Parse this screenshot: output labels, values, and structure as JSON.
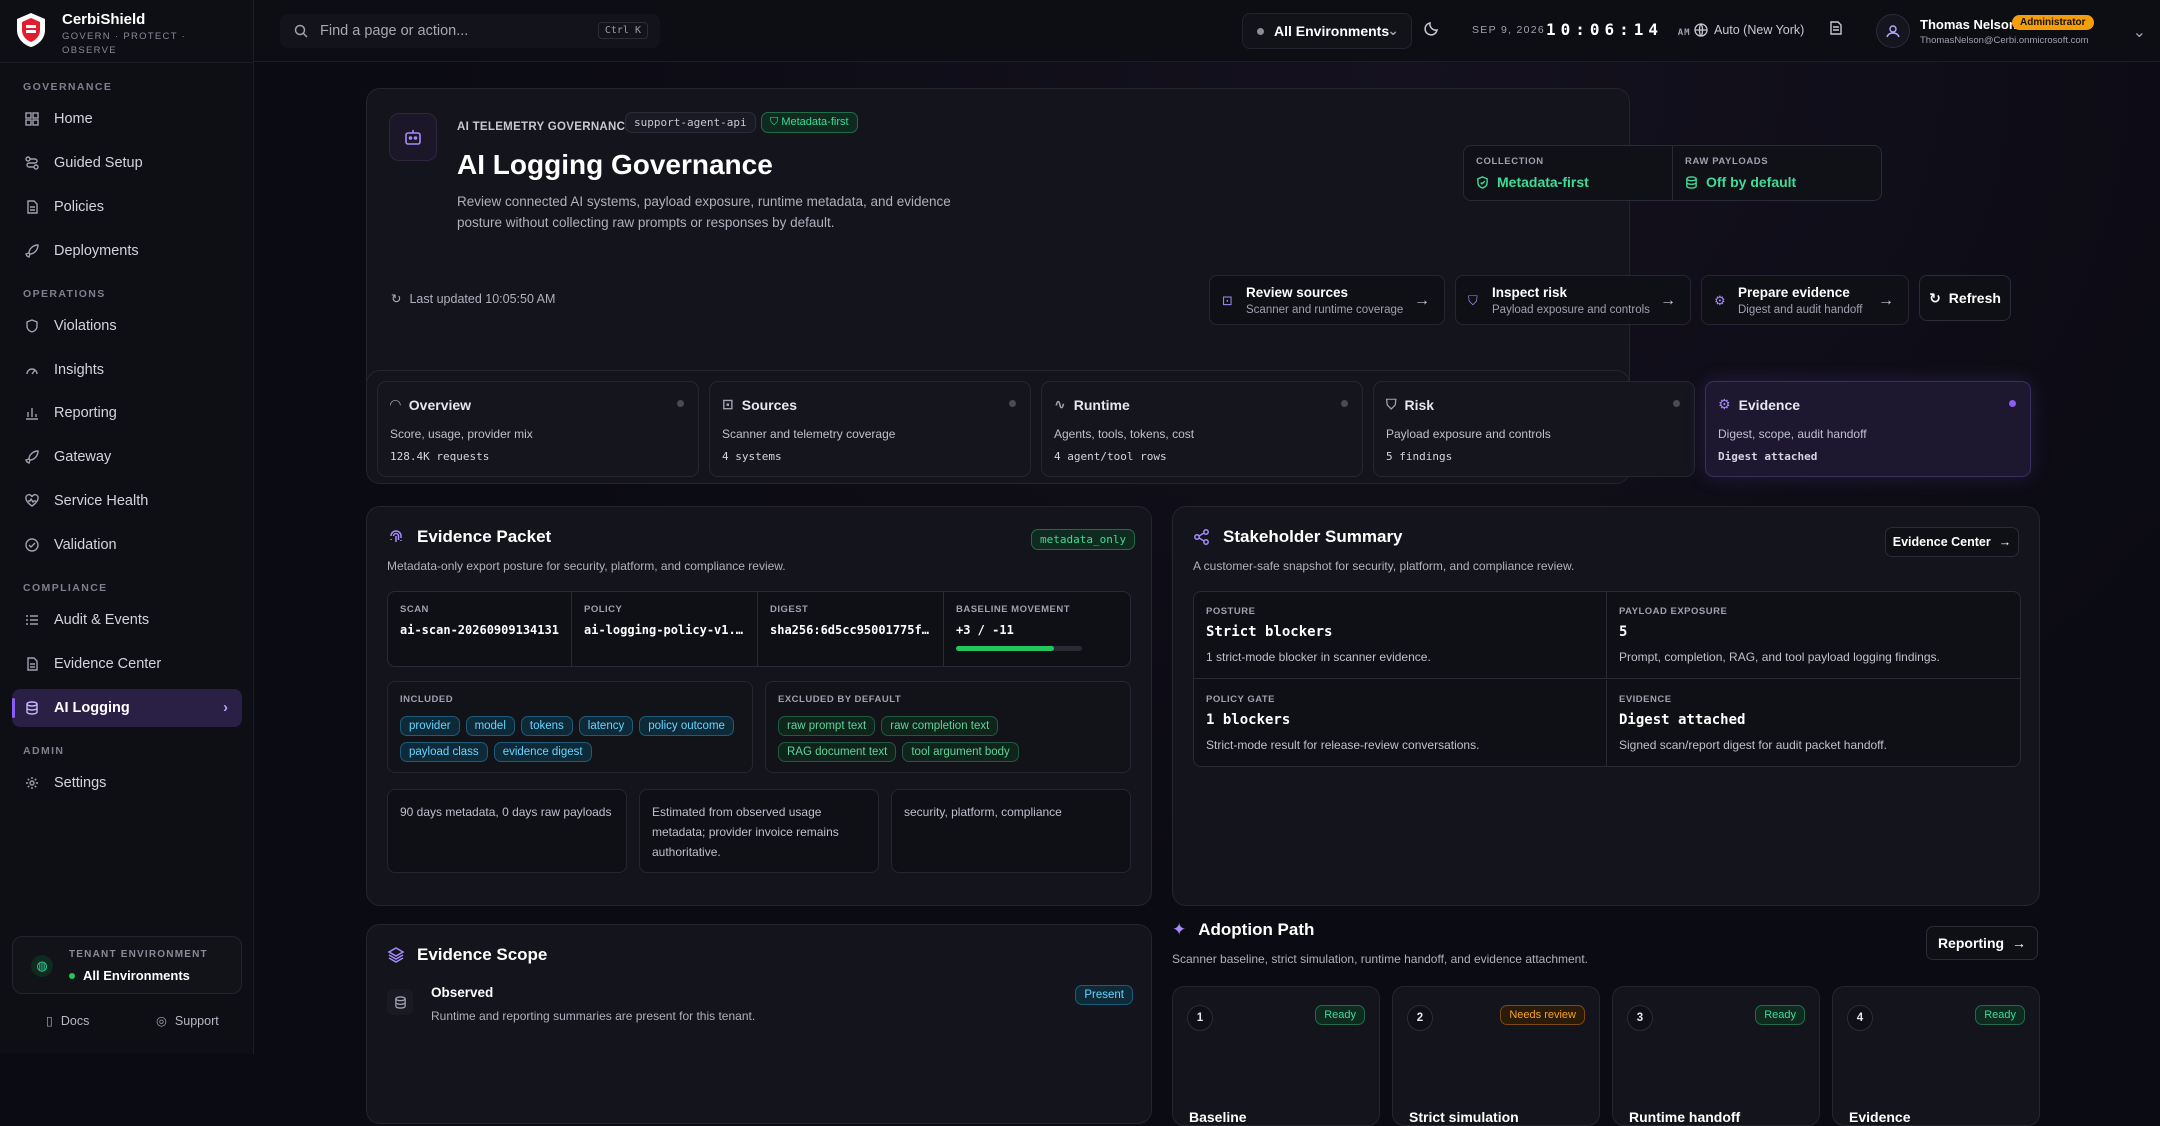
{
  "brand": {
    "name": "CerbiShield",
    "tagline": "GOVERN · PROTECT · OBSERVE"
  },
  "sidebar": {
    "sections": [
      {
        "label": "GOVERNANCE",
        "items": [
          {
            "label": "Home",
            "icon": "grid-icon"
          },
          {
            "label": "Guided Setup",
            "icon": "route-icon"
          },
          {
            "label": "Policies",
            "icon": "document-icon"
          },
          {
            "label": "Deployments",
            "icon": "rocket-icon"
          }
        ]
      },
      {
        "label": "OPERATIONS",
        "items": [
          {
            "label": "Violations",
            "icon": "shield-icon"
          },
          {
            "label": "Insights",
            "icon": "gauge-icon"
          },
          {
            "label": "Reporting",
            "icon": "bar-chart-icon"
          },
          {
            "label": "Gateway",
            "icon": "rocket-icon"
          },
          {
            "label": "Service Health",
            "icon": "heart-pulse-icon"
          },
          {
            "label": "Validation",
            "icon": "check-circle-icon"
          }
        ]
      },
      {
        "label": "COMPLIANCE",
        "items": [
          {
            "label": "Audit & Events",
            "icon": "list-icon"
          },
          {
            "label": "Evidence Center",
            "icon": "document-icon"
          },
          {
            "label": "AI Logging",
            "icon": "database-icon"
          }
        ]
      },
      {
        "label": "ADMIN",
        "items": [
          {
            "label": "Settings",
            "icon": "gear-icon"
          }
        ]
      }
    ],
    "active": "AI Logging",
    "tenant": {
      "label": "TENANT ENVIRONMENT",
      "value": "All Environments"
    },
    "footer": {
      "docs": "Docs",
      "support": "Support"
    }
  },
  "topbar": {
    "search_placeholder": "Find a page or action...",
    "search_shortcut": "Ctrl K",
    "environment": "All Environments",
    "date": "SEP 9, 2026",
    "time": "10:06:14",
    "ampm": "AM",
    "timezone": "Auto (New York)",
    "user": {
      "name": "Thomas Nelson",
      "role": "Administrator",
      "email": "ThomasNelson@Cerbi.onmicrosoft.com"
    }
  },
  "hero": {
    "eyebrow": "AI TELEMETRY GOVERNANCE",
    "service_pill": "support-agent-api",
    "mode_pill": "Metadata-first",
    "title": "AI Logging Governance",
    "description": "Review connected AI systems, payload exposure, runtime metadata, and evidence posture without collecting raw prompts or responses by default.",
    "kpis": [
      {
        "label": "COLLECTION",
        "value": "Metadata-first"
      },
      {
        "label": "RAW PAYLOADS",
        "value": "Off by default"
      }
    ],
    "last_updated": "Last updated 10:05:50 AM",
    "actions": [
      {
        "title": "Review sources",
        "subtitle": "Scanner and runtime coverage"
      },
      {
        "title": "Inspect risk",
        "subtitle": "Payload exposure and controls"
      },
      {
        "title": "Prepare evidence",
        "subtitle": "Digest and audit handoff"
      }
    ],
    "refresh": "Refresh"
  },
  "tabs": [
    {
      "title": "Overview",
      "subtitle": "Score, usage, provider mix",
      "meta": "128.4K requests"
    },
    {
      "title": "Sources",
      "subtitle": "Scanner and telemetry coverage",
      "meta": "4 systems"
    },
    {
      "title": "Runtime",
      "subtitle": "Agents, tools, tokens, cost",
      "meta": "4 agent/tool rows"
    },
    {
      "title": "Risk",
      "subtitle": "Payload exposure and controls",
      "meta": "5 findings"
    },
    {
      "title": "Evidence",
      "subtitle": "Digest, scope, audit handoff",
      "meta": "Digest attached"
    }
  ],
  "evidence_packet": {
    "title": "Evidence Packet",
    "subtitle": "Metadata-only export posture for security, platform, and compliance review.",
    "badge": "metadata_only",
    "scan": {
      "label": "SCAN",
      "value": "ai-scan-20260909134131"
    },
    "policy": {
      "label": "POLICY",
      "value": "ai-logging-policy-v1.0.0"
    },
    "digest": {
      "label": "DIGEST",
      "value": "sha256:6d5cc95001775fe0…"
    },
    "baseline": {
      "label": "BASELINE MOVEMENT",
      "value": "+3 / -11",
      "progress": 0.78
    },
    "included_label": "INCLUDED",
    "included": [
      "provider",
      "model",
      "tokens",
      "latency",
      "policy outcome",
      "payload class",
      "evidence digest"
    ],
    "excluded_label": "EXCLUDED BY DEFAULT",
    "excluded": [
      "raw prompt text",
      "raw completion text",
      "RAG document text",
      "tool argument body"
    ],
    "notes": [
      "90 days metadata, 0 days raw payloads",
      "Estimated from observed usage metadata; provider invoice remains authoritative.",
      "security, platform, compliance"
    ]
  },
  "stakeholder": {
    "title": "Stakeholder Summary",
    "subtitle": "A customer-safe snapshot for security, platform, and compliance review.",
    "button": "Evidence Center",
    "cells": [
      {
        "label": "POSTURE",
        "value": "Strict blockers",
        "desc": "1 strict-mode blocker in scanner evidence."
      },
      {
        "label": "PAYLOAD EXPOSURE",
        "value": "5",
        "desc": "Prompt, completion, RAG, and tool payload logging findings."
      },
      {
        "label": "POLICY GATE",
        "value": "1 blockers",
        "desc": "Strict-mode result for release-review conversations."
      },
      {
        "label": "EVIDENCE",
        "value": "Digest attached",
        "desc": "Signed scan/report digest for audit packet handoff."
      }
    ]
  },
  "scope": {
    "title": "Evidence Scope",
    "row": {
      "title": "Observed",
      "subtitle": "Runtime and reporting summaries are present for this tenant.",
      "badge": "Present"
    }
  },
  "adoption": {
    "title": "Adoption Path",
    "subtitle": "Scanner baseline, strict simulation, runtime handoff, and evidence attachment.",
    "button": "Reporting",
    "steps": [
      {
        "n": "1",
        "status": "Ready",
        "title": "Baseline"
      },
      {
        "n": "2",
        "status": "Needs review",
        "title": "Strict simulation"
      },
      {
        "n": "3",
        "status": "Ready",
        "title": "Runtime handoff"
      },
      {
        "n": "4",
        "status": "Ready",
        "title": "Evidence"
      }
    ]
  },
  "colors": {
    "accent": "#8b5cf6",
    "success": "#3ddc97",
    "warning": "#f5a524",
    "info": "#67d4ff"
  }
}
